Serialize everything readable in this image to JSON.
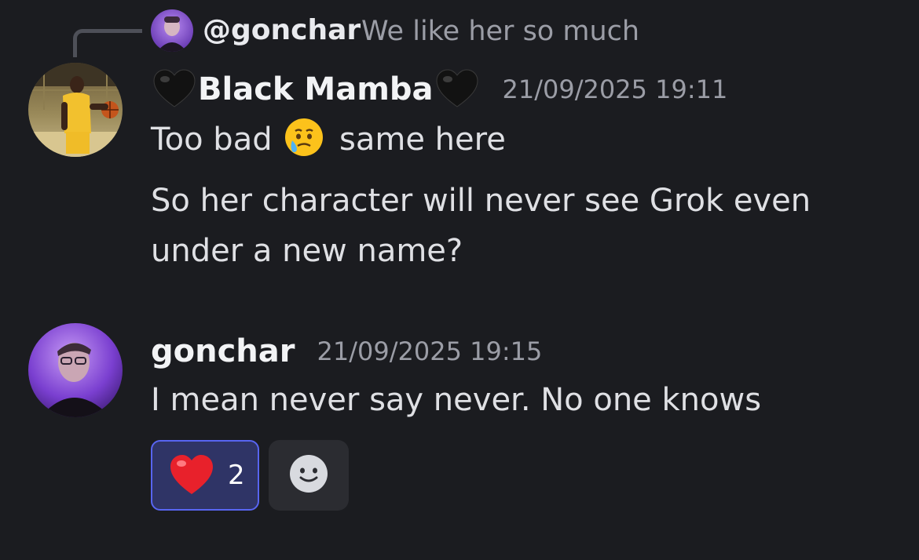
{
  "reply": {
    "author": "@gonchar",
    "text": "We like her so much"
  },
  "messages": [
    {
      "author": "Black Mamba",
      "timestamp": "21/09/2025 19:11",
      "lines": [
        {
          "before": "Too bad",
          "emoji": "face-holding-back-tears",
          "after": "same here"
        },
        {
          "text": "So her character will never see Grok even"
        },
        {
          "text": "under a new name?"
        }
      ]
    },
    {
      "author": "gonchar",
      "timestamp": "21/09/2025 19:15",
      "lines": [
        {
          "text": "I mean never say never. No one knows"
        }
      ]
    }
  ],
  "reactions": [
    {
      "emoji": "red-heart",
      "count": "2",
      "active": true
    }
  ],
  "colors": {
    "background": "#1b1c20",
    "accent": "#5865f2",
    "reaction_bg": "#2f3466",
    "muted": "#9b9da6"
  }
}
